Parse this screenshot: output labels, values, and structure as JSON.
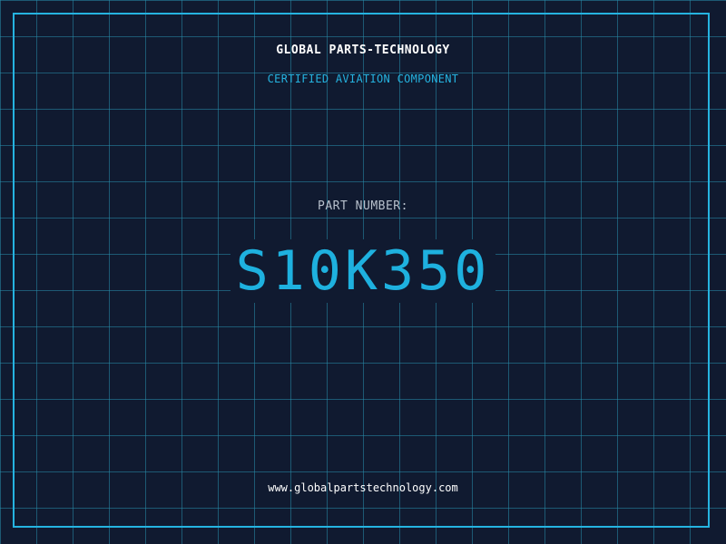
{
  "header": {
    "company": "GLOBAL PARTS-TECHNOLOGY",
    "subtitle": "CERTIFIED AVIATION COMPONENT"
  },
  "part": {
    "label": "PART NUMBER:",
    "number": "S10K350"
  },
  "footer": {
    "url": "www.globalpartstechnology.com"
  },
  "colors": {
    "background": "#101a30",
    "grid": "#288caa",
    "frame": "#25b3e0",
    "accent": "#1eb1df",
    "label": "#b7c0cc",
    "text": "#ffffff"
  }
}
